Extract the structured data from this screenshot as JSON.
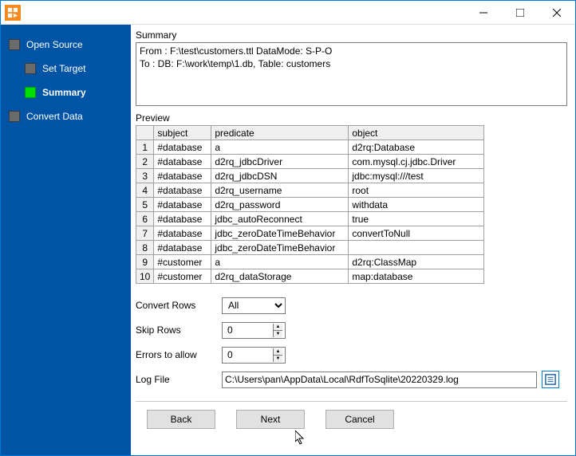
{
  "titlebar": {},
  "sidebar": {
    "items": [
      {
        "label": "Open Source"
      },
      {
        "label": "Set Target"
      },
      {
        "label": "Summary"
      },
      {
        "label": "Convert Data"
      }
    ]
  },
  "summary": {
    "heading": "Summary",
    "line1": "From : F:\\test\\customers.ttl DataMode: S-P-O",
    "line2": "To : DB: F:\\work\\temp\\1.db, Table: customers"
  },
  "preview": {
    "heading": "Preview",
    "columns": [
      "subject",
      "predicate",
      "object"
    ],
    "rows": [
      {
        "n": "1",
        "subject": "#database",
        "predicate": "a",
        "object": "d2rq:Database"
      },
      {
        "n": "2",
        "subject": "#database",
        "predicate": "d2rq_jdbcDriver",
        "object": "com.mysql.cj.jdbc.Driver"
      },
      {
        "n": "3",
        "subject": "#database",
        "predicate": "d2rq_jdbcDSN",
        "object": "jdbc:mysql:///test"
      },
      {
        "n": "4",
        "subject": "#database",
        "predicate": "d2rq_username",
        "object": "root"
      },
      {
        "n": "5",
        "subject": "#database",
        "predicate": "d2rq_password",
        "object": "withdata"
      },
      {
        "n": "6",
        "subject": "#database",
        "predicate": "jdbc_autoReconnect",
        "object": "true"
      },
      {
        "n": "7",
        "subject": "#database",
        "predicate": "jdbc_zeroDateTimeBehavior",
        "object": "convertToNull"
      },
      {
        "n": "8",
        "subject": "#database",
        "predicate": "jdbc_zeroDateTimeBehavior",
        "object": ""
      },
      {
        "n": "9",
        "subject": "#customer",
        "predicate": "a",
        "object": "d2rq:ClassMap"
      },
      {
        "n": "10",
        "subject": "#customer",
        "predicate": "d2rq_dataStorage",
        "object": "map:database"
      }
    ]
  },
  "form": {
    "convert_rows_label": "Convert Rows",
    "convert_rows_value": "All",
    "skip_rows_label": "Skip Rows",
    "skip_rows_value": "0",
    "errors_label": "Errors to allow",
    "errors_value": "0",
    "logfile_label": "Log File",
    "logfile_value": "C:\\Users\\pan\\AppData\\Local\\RdfToSqlite\\20220329.log"
  },
  "buttons": {
    "back": "Back",
    "next": "Next",
    "cancel": "Cancel"
  }
}
